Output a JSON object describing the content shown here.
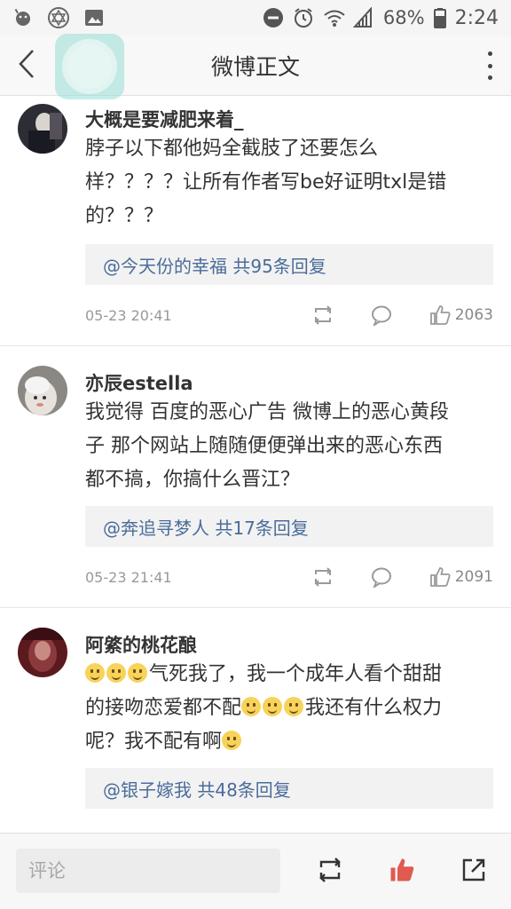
{
  "status_bar": {
    "battery": "68%",
    "time": "2:24"
  },
  "nav": {
    "title": "微博正文"
  },
  "comments": [
    {
      "username": "大概是要减肥来着_",
      "lines": [
        "脖子以下都他妈全截肢了还要怎么",
        "样？？？？让所有作者写be好证明txl是错",
        "的？？？"
      ],
      "reply": "@今天份的幸福 共95条回复",
      "timestamp": "05-23 20:41",
      "likes": "2063"
    },
    {
      "username": "亦辰estella",
      "lines": [
        "我觉得 百度的恶心广告 微博上的恶心黄段",
        "子 那个网站上随随便便弹出来的恶心东西",
        "都不搞，你搞什么晋江？"
      ],
      "reply": "@奔追寻梦人 共17条回复",
      "timestamp": "05-23 21:41",
      "likes": "2091"
    },
    {
      "username": "阿綮的桃花酿",
      "line1_text": "气死我了，我一个成年人看个甜甜",
      "line2_text": "的接吻恋爱都不配",
      "line2_text_b": "我还有什么权力",
      "line3_text": "呢？我不配有啊",
      "reply": "@银子嫁我 共48条回复"
    }
  ],
  "bottom_bar": {
    "comment_placeholder": "评论"
  },
  "colors": {
    "link": "#4a6c9a",
    "like_active": "#e05a4f",
    "icon_gray": "#9a9a9a"
  },
  "icons": [
    "android-icon",
    "star-of-david-icon",
    "image-icon",
    "do-not-disturb-icon",
    "alarm-icon",
    "wifi-icon",
    "signal-icon",
    "battery-icon",
    "back-arrow-icon",
    "more-vertical-icon",
    "repost-icon",
    "comment-icon",
    "like-icon",
    "share-icon"
  ]
}
